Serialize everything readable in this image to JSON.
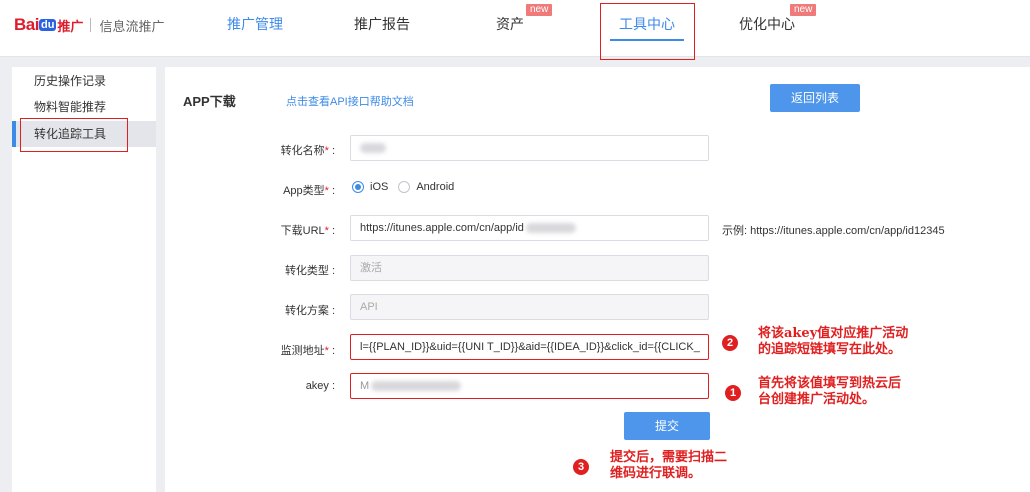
{
  "header": {
    "logo_bai": "Bai",
    "logo_du": "du",
    "logo_tg": "推广",
    "product": "信息流推广",
    "nav": [
      {
        "label": "推广管理",
        "badge": ""
      },
      {
        "label": "推广报告",
        "badge": ""
      },
      {
        "label": "资产",
        "badge": "new"
      },
      {
        "label": "工具中心",
        "badge": ""
      },
      {
        "label": "优化中心",
        "badge": "new"
      }
    ]
  },
  "sidebar": {
    "items": [
      {
        "label": "历史操作记录"
      },
      {
        "label": "物料智能推荐"
      },
      {
        "label": "转化追踪工具"
      }
    ]
  },
  "main": {
    "title": "APP下载",
    "help_link": "点击查看API接口帮助文档",
    "back_button": "返回列表",
    "form": {
      "name_label": "转化名称",
      "app_type_label": "App类型",
      "ios_label": "iOS",
      "android_label": "Android",
      "url_label": "下载URL",
      "url_value": "https://itunes.apple.com/cn/app/id",
      "url_hint": "示例: https://itunes.apple.com/cn/app/id12345",
      "conv_type_label": "转化类型",
      "conv_type_value": "激活",
      "conv_plan_label": "转化方案",
      "conv_plan_value": "API",
      "monitor_label": "监测地址",
      "monitor_value": "l={{PLAN_ID}}&uid={{UNI   T_ID}}&aid={{IDEA_ID}}&click_id={{CLICK_",
      "akey_label": "akey",
      "akey_value": "M",
      "required_mark": "*",
      "colon": ":",
      "submit": "提交"
    }
  },
  "annotations": [
    {
      "num": "2",
      "line1": "将该akey值对应推广活动",
      "line2": "的追踪短链填写在此处。"
    },
    {
      "num": "1",
      "line1": "首先将该值填写到热云后",
      "line2": "台创建推广活动处。"
    },
    {
      "num": "3",
      "line1": "提交后，需要扫描二",
      "line2": "维码进行联调。"
    }
  ],
  "colors": {
    "accent": "#3d8ae8",
    "annotation": "#e02020",
    "new_badge": "#ee7a7a"
  }
}
